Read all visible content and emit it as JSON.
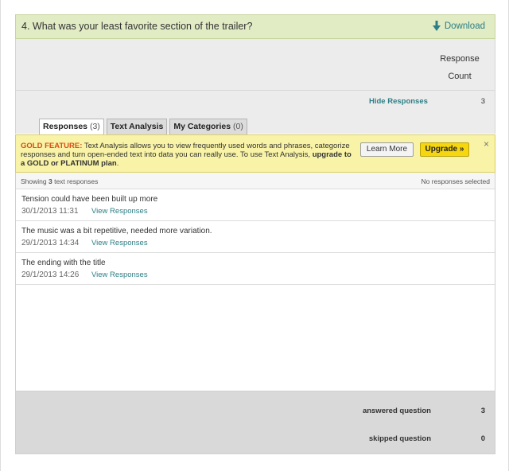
{
  "question": {
    "title": "4. What was your least favorite section of the trailer?",
    "download_label": "Download",
    "download_icon": "arrow-down-icon"
  },
  "response_count": {
    "label_line1": "Response",
    "label_line2": "Count"
  },
  "responses_row": {
    "hide_label": "Hide Responses",
    "count": "3"
  },
  "tabs": [
    {
      "label": "Responses",
      "count": "(3)"
    },
    {
      "label": "Text Analysis",
      "count": ""
    },
    {
      "label": "My Categories",
      "count": "(0)"
    }
  ],
  "gold_banner": {
    "label": "GOLD FEATURE:",
    "text": "Text Analysis allows you to view frequently used words and phrases, categorize responses and turn open-ended text into data you can really use. To use Text Analysis,",
    "upgrade_text": "upgrade to a GOLD or PLATINUM plan",
    "period": ".",
    "learn_more": "Learn More",
    "upgrade_button": "Upgrade »",
    "close": "×"
  },
  "list_header": {
    "showing_prefix": "Showing",
    "showing_count": "3",
    "showing_suffix": "text responses",
    "selection_status": "No responses selected"
  },
  "responses": [
    {
      "text": "Tension could have been built up more",
      "date": "30/1/2013 11:31",
      "link": "View Responses"
    },
    {
      "text": "The music was a bit repetitive, needed more variation.",
      "date": "29/1/2013 14:34",
      "link": "View Responses"
    },
    {
      "text": "The ending with the title",
      "date": "29/1/2013 14:26",
      "link": "View Responses"
    }
  ],
  "summary": {
    "answered_label": "answered question",
    "answered_value": "3",
    "skipped_label": "skipped question",
    "skipped_value": "0"
  },
  "colors": {
    "accent_link": "#2c7f86",
    "question_bar": "#e1ebc4",
    "gold_banner": "#f8f3a6",
    "gold_label": "#d94c17",
    "upgrade_button": "#f5d60f"
  }
}
